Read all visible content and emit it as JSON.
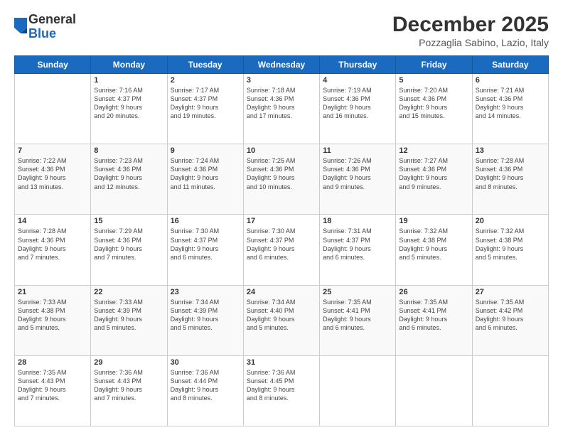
{
  "logo": {
    "general": "General",
    "blue": "Blue"
  },
  "header": {
    "month": "December 2025",
    "location": "Pozzaglia Sabino, Lazio, Italy"
  },
  "weekdays": [
    "Sunday",
    "Monday",
    "Tuesday",
    "Wednesday",
    "Thursday",
    "Friday",
    "Saturday"
  ],
  "weeks": [
    [
      {
        "num": "",
        "info": ""
      },
      {
        "num": "1",
        "info": "Sunrise: 7:16 AM\nSunset: 4:37 PM\nDaylight: 9 hours\nand 20 minutes."
      },
      {
        "num": "2",
        "info": "Sunrise: 7:17 AM\nSunset: 4:37 PM\nDaylight: 9 hours\nand 19 minutes."
      },
      {
        "num": "3",
        "info": "Sunrise: 7:18 AM\nSunset: 4:36 PM\nDaylight: 9 hours\nand 17 minutes."
      },
      {
        "num": "4",
        "info": "Sunrise: 7:19 AM\nSunset: 4:36 PM\nDaylight: 9 hours\nand 16 minutes."
      },
      {
        "num": "5",
        "info": "Sunrise: 7:20 AM\nSunset: 4:36 PM\nDaylight: 9 hours\nand 15 minutes."
      },
      {
        "num": "6",
        "info": "Sunrise: 7:21 AM\nSunset: 4:36 PM\nDaylight: 9 hours\nand 14 minutes."
      }
    ],
    [
      {
        "num": "7",
        "info": "Sunrise: 7:22 AM\nSunset: 4:36 PM\nDaylight: 9 hours\nand 13 minutes."
      },
      {
        "num": "8",
        "info": "Sunrise: 7:23 AM\nSunset: 4:36 PM\nDaylight: 9 hours\nand 12 minutes."
      },
      {
        "num": "9",
        "info": "Sunrise: 7:24 AM\nSunset: 4:36 PM\nDaylight: 9 hours\nand 11 minutes."
      },
      {
        "num": "10",
        "info": "Sunrise: 7:25 AM\nSunset: 4:36 PM\nDaylight: 9 hours\nand 10 minutes."
      },
      {
        "num": "11",
        "info": "Sunrise: 7:26 AM\nSunset: 4:36 PM\nDaylight: 9 hours\nand 9 minutes."
      },
      {
        "num": "12",
        "info": "Sunrise: 7:27 AM\nSunset: 4:36 PM\nDaylight: 9 hours\nand 9 minutes."
      },
      {
        "num": "13",
        "info": "Sunrise: 7:28 AM\nSunset: 4:36 PM\nDaylight: 9 hours\nand 8 minutes."
      }
    ],
    [
      {
        "num": "14",
        "info": "Sunrise: 7:28 AM\nSunset: 4:36 PM\nDaylight: 9 hours\nand 7 minutes."
      },
      {
        "num": "15",
        "info": "Sunrise: 7:29 AM\nSunset: 4:36 PM\nDaylight: 9 hours\nand 7 minutes."
      },
      {
        "num": "16",
        "info": "Sunrise: 7:30 AM\nSunset: 4:37 PM\nDaylight: 9 hours\nand 6 minutes."
      },
      {
        "num": "17",
        "info": "Sunrise: 7:30 AM\nSunset: 4:37 PM\nDaylight: 9 hours\nand 6 minutes."
      },
      {
        "num": "18",
        "info": "Sunrise: 7:31 AM\nSunset: 4:37 PM\nDaylight: 9 hours\nand 6 minutes."
      },
      {
        "num": "19",
        "info": "Sunrise: 7:32 AM\nSunset: 4:38 PM\nDaylight: 9 hours\nand 5 minutes."
      },
      {
        "num": "20",
        "info": "Sunrise: 7:32 AM\nSunset: 4:38 PM\nDaylight: 9 hours\nand 5 minutes."
      }
    ],
    [
      {
        "num": "21",
        "info": "Sunrise: 7:33 AM\nSunset: 4:38 PM\nDaylight: 9 hours\nand 5 minutes."
      },
      {
        "num": "22",
        "info": "Sunrise: 7:33 AM\nSunset: 4:39 PM\nDaylight: 9 hours\nand 5 minutes."
      },
      {
        "num": "23",
        "info": "Sunrise: 7:34 AM\nSunset: 4:39 PM\nDaylight: 9 hours\nand 5 minutes."
      },
      {
        "num": "24",
        "info": "Sunrise: 7:34 AM\nSunset: 4:40 PM\nDaylight: 9 hours\nand 5 minutes."
      },
      {
        "num": "25",
        "info": "Sunrise: 7:35 AM\nSunset: 4:41 PM\nDaylight: 9 hours\nand 6 minutes."
      },
      {
        "num": "26",
        "info": "Sunrise: 7:35 AM\nSunset: 4:41 PM\nDaylight: 9 hours\nand 6 minutes."
      },
      {
        "num": "27",
        "info": "Sunrise: 7:35 AM\nSunset: 4:42 PM\nDaylight: 9 hours\nand 6 minutes."
      }
    ],
    [
      {
        "num": "28",
        "info": "Sunrise: 7:35 AM\nSunset: 4:43 PM\nDaylight: 9 hours\nand 7 minutes."
      },
      {
        "num": "29",
        "info": "Sunrise: 7:36 AM\nSunset: 4:43 PM\nDaylight: 9 hours\nand 7 minutes."
      },
      {
        "num": "30",
        "info": "Sunrise: 7:36 AM\nSunset: 4:44 PM\nDaylight: 9 hours\nand 8 minutes."
      },
      {
        "num": "31",
        "info": "Sunrise: 7:36 AM\nSunset: 4:45 PM\nDaylight: 9 hours\nand 8 minutes."
      },
      {
        "num": "",
        "info": ""
      },
      {
        "num": "",
        "info": ""
      },
      {
        "num": "",
        "info": ""
      }
    ]
  ]
}
